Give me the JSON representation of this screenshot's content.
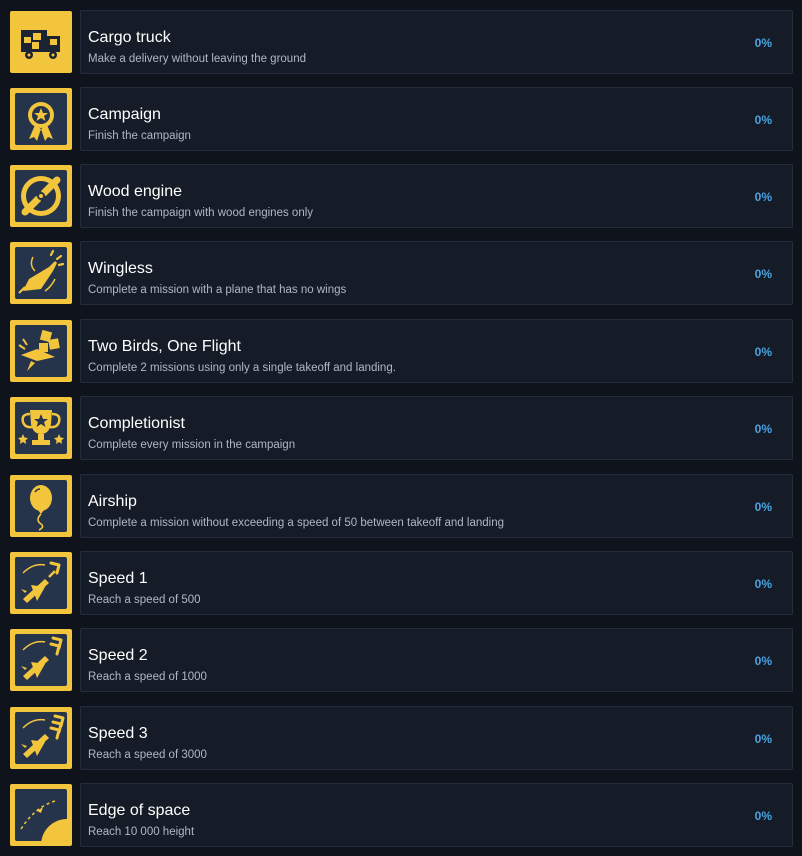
{
  "achievements": [
    {
      "title": "Cargo truck",
      "desc": "Make a delivery without leaving the ground",
      "pct": "0%",
      "icon": "cargo-truck-icon"
    },
    {
      "title": "Campaign",
      "desc": "Finish the campaign",
      "pct": "0%",
      "icon": "medal-icon"
    },
    {
      "title": "Wood engine",
      "desc": "Finish the campaign with wood engines only",
      "pct": "0%",
      "icon": "propeller-icon"
    },
    {
      "title": "Wingless",
      "desc": "Complete a mission with a plane that has no wings",
      "pct": "0%",
      "icon": "wingless-plane-icon"
    },
    {
      "title": "Two Birds, One Flight",
      "desc": "Complete 2 missions using only a single takeoff and landing.",
      "pct": "0%",
      "icon": "crates-plane-icon"
    },
    {
      "title": "Completionist",
      "desc": "Complete every mission in the campaign",
      "pct": "0%",
      "icon": "trophy-icon"
    },
    {
      "title": "Airship",
      "desc": "Complete a mission without exceeding a speed of 50 between takeoff and landing",
      "pct": "0%",
      "icon": "balloon-icon"
    },
    {
      "title": "Speed 1",
      "desc": "Reach a speed of 500",
      "pct": "0%",
      "icon": "plane-chevron-1-icon"
    },
    {
      "title": "Speed 2",
      "desc": "Reach a speed of 1000",
      "pct": "0%",
      "icon": "plane-chevron-2-icon"
    },
    {
      "title": "Speed 3",
      "desc": "Reach a speed of 3000",
      "pct": "0%",
      "icon": "plane-chevron-3-icon"
    },
    {
      "title": "Edge of space",
      "desc": "Reach 10 000 height",
      "pct": "0%",
      "icon": "planet-orbit-icon"
    }
  ],
  "colors": {
    "accent": "#f2c53d",
    "percent": "#4ba3e0",
    "panel": "#151c27",
    "background": "#0f141c"
  }
}
